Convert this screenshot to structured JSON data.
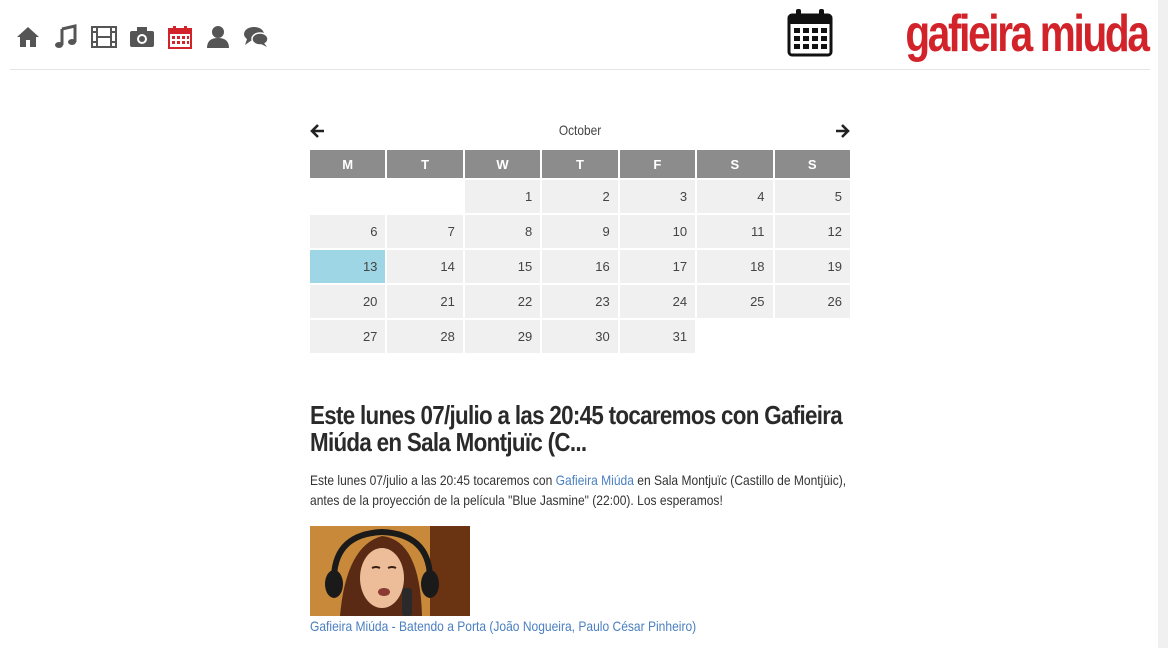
{
  "nav": {
    "icons": [
      "home-icon",
      "music-icon",
      "film-icon",
      "camera-icon",
      "calendar-icon",
      "user-icon",
      "comments-icon"
    ],
    "active": "calendar-icon",
    "icon_color": "#555555",
    "active_color": "#d2232a"
  },
  "brand": {
    "text": "gafieira miuda",
    "color": "#d2232a"
  },
  "calendar": {
    "month": "October",
    "days": [
      "M",
      "T",
      "W",
      "T",
      "F",
      "S",
      "S"
    ],
    "weeks": [
      [
        "",
        "",
        "1",
        "2",
        "3",
        "4",
        "5"
      ],
      [
        "6",
        "7",
        "8",
        "9",
        "10",
        "11",
        "12"
      ],
      [
        "13",
        "14",
        "15",
        "16",
        "17",
        "18",
        "19"
      ],
      [
        "20",
        "21",
        "22",
        "23",
        "24",
        "25",
        "26"
      ],
      [
        "27",
        "28",
        "29",
        "30",
        "31",
        "",
        ""
      ]
    ],
    "today": "13"
  },
  "post": {
    "title": "Este lunes 07/julio a las 20:45 tocaremos con Gafieira Miúda en Sala Montjuïc (C...",
    "body_before": "Este lunes 07/julio a las 20:45 tocaremos con ",
    "body_link": "Gafieira Miúda",
    "body_after": " en Sala Montjuïc (Castillo de Montjüic), antes de la proyección de la película \"Blue Jasmine\" (22:00). Los esperamos!",
    "video_caption": "Gafieira Miúda - Batendo a Porta (João Nogueira, Paulo César Pinheiro)"
  }
}
